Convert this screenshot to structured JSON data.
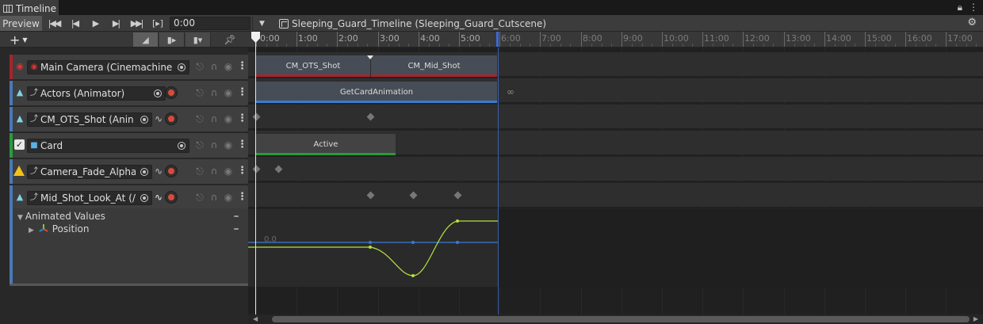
{
  "window": {
    "tab_title": "Timeline",
    "lock_icon": "lock-icon",
    "menu_icon": "kebab-icon"
  },
  "toolbar": {
    "preview_label": "Preview",
    "time_value": "0:00",
    "asset_label": "Sleeping_Guard_Timeline (Sleeping_Guard_Cutscene)",
    "buttons": [
      "go-to-start-icon",
      "previous-frame-icon",
      "play-icon",
      "next-frame-icon",
      "go-to-end-icon",
      "play-range-icon"
    ]
  },
  "header": {
    "add_label": "+",
    "buttons": [
      "clip-edit-mode-icon",
      "ripple-mode-icon",
      "replace-mode-icon",
      "pin-icon"
    ]
  },
  "ruler": {
    "labels": [
      "0:00",
      "1:00",
      "2:00",
      "3:00",
      "4:00",
      "5:00",
      "6:00",
      "7:00",
      "8:00",
      "9:00",
      "10:00",
      "11:00",
      "12:00",
      "13:00",
      "14:00",
      "15:00",
      "16:00",
      "17:00"
    ]
  },
  "tracks": [
    {
      "name": "Main Camera (Cinemachine",
      "type": "cinemachine-track",
      "color": "#a8232b"
    },
    {
      "name": "Actors (Animator)",
      "type": "animation-track",
      "color": "#4a78b4"
    },
    {
      "name": "CM_OTS_Shot (Anin",
      "type": "animation-track",
      "color": "#4a78b4"
    },
    {
      "name": "Card",
      "type": "activation-track",
      "color": "#2a9a3c"
    },
    {
      "name": "Camera_Fade_Alpha",
      "type": "animation-track",
      "color": "#4a78b4"
    },
    {
      "name": "Mid_Shot_Look_At (/",
      "type": "animation-track",
      "color": "#4a78b4"
    }
  ],
  "clips": {
    "camera": [
      "CM_OTS_Shot",
      "CM_Mid_Shot"
    ],
    "actors": "GetCardAnimation",
    "card": "Active"
  },
  "curves": {
    "section_label": "Animated Values",
    "property_label": "Position",
    "zero_label": "0.0"
  },
  "colors": {
    "accent_blue": "#3c6ad6",
    "curve_green": "#b4e23c",
    "curve_blue": "#3a7bd5",
    "record_red": "#d94a3a"
  }
}
